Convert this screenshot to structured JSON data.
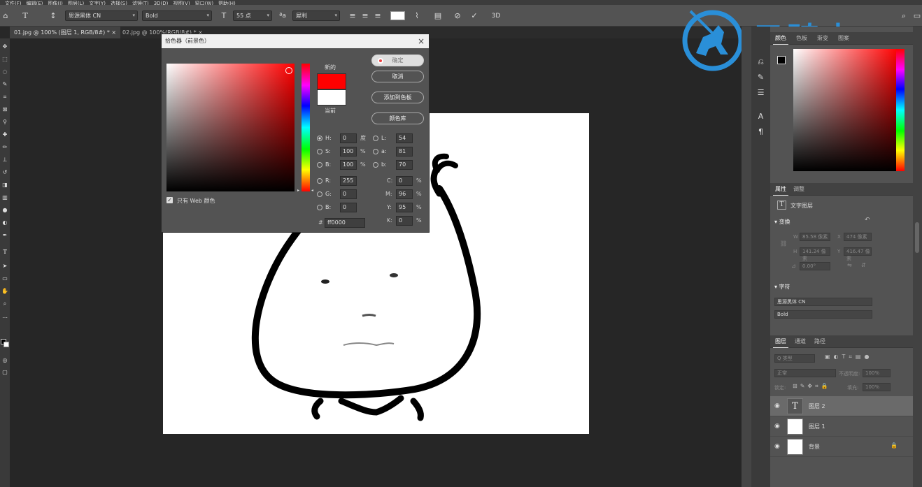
{
  "menubar": [
    "文件(F)",
    "编辑(E)",
    "图像(I)",
    "图层(L)",
    "文字(Y)",
    "选择(S)",
    "滤镜(T)",
    "3D(D)",
    "视图(V)",
    "窗口(W)",
    "帮助(H)"
  ],
  "options": {
    "font_family": "思源黑体 CN",
    "font_style": "Bold",
    "font_size": "55 点",
    "antialias": "犀利",
    "three_d": "3D"
  },
  "tabs": [
    {
      "label": "01.jpg @ 100% (图层 1, RGB/8#) *",
      "close": "×"
    },
    {
      "label": "02.jpg @ 100%(RGB/8#) *",
      "close": "×"
    }
  ],
  "dialog": {
    "title": "拾色器（前景色）",
    "close": "×",
    "new_label": "新的",
    "current_label": "当前",
    "new_color": "#ff0000",
    "current_color": "#ffffff",
    "buttons": {
      "ok": "确定",
      "cancel": "取消",
      "add_swatch": "添加到色板",
      "color_library": "颜色库"
    },
    "hsb": [
      {
        "label": "H:",
        "value": "0",
        "unit": "度"
      },
      {
        "label": "S:",
        "value": "100",
        "unit": "%"
      },
      {
        "label": "B:",
        "value": "100",
        "unit": "%"
      }
    ],
    "lab": [
      {
        "label": "L:",
        "value": "54"
      },
      {
        "label": "a:",
        "value": "81"
      },
      {
        "label": "b:",
        "value": "70"
      }
    ],
    "rgb": [
      {
        "label": "R:",
        "value": "255"
      },
      {
        "label": "G:",
        "value": "0"
      },
      {
        "label": "B:",
        "value": "0"
      }
    ],
    "cmyk": [
      {
        "label": "C:",
        "value": "0",
        "unit": "%"
      },
      {
        "label": "M:",
        "value": "96",
        "unit": "%"
      },
      {
        "label": "Y:",
        "value": "95",
        "unit": "%"
      },
      {
        "label": "K:",
        "value": "0",
        "unit": "%"
      }
    ],
    "hex_label": "#",
    "hex": "ff0000",
    "web_only": "只有 Web 颜色"
  },
  "watermark": "云骑士",
  "panel": {
    "color_tabs": [
      "颜色",
      "色板",
      "渐变",
      "图案"
    ],
    "props_tabs": [
      "属性",
      "调整"
    ],
    "text_layer": "文字图层",
    "transform_title": "变换",
    "transform": {
      "w_label": "W",
      "w": "85.58 像素",
      "x_label": "X",
      "x": "474 像素",
      "h_label": "H",
      "h": "141.24 像素",
      "y_label": "Y",
      "y": "416.47 像素",
      "angle": "0.00°"
    },
    "char_title": "字符",
    "char_font": "思源黑体 CN",
    "char_style": "Bold",
    "layer_tabs": [
      "图层",
      "通道",
      "路径"
    ],
    "layer_filter": "Q 类型",
    "blend_mode": "正常",
    "opacity_label": "不透明度:",
    "opacity": "100%",
    "lock_label": "锁定:",
    "fill_label": "填充:",
    "fill": "100%",
    "layers": [
      {
        "name": "图层 2",
        "type": "T"
      },
      {
        "name": "图层 1",
        "type": ""
      },
      {
        "name": "背景",
        "type": ""
      }
    ]
  }
}
